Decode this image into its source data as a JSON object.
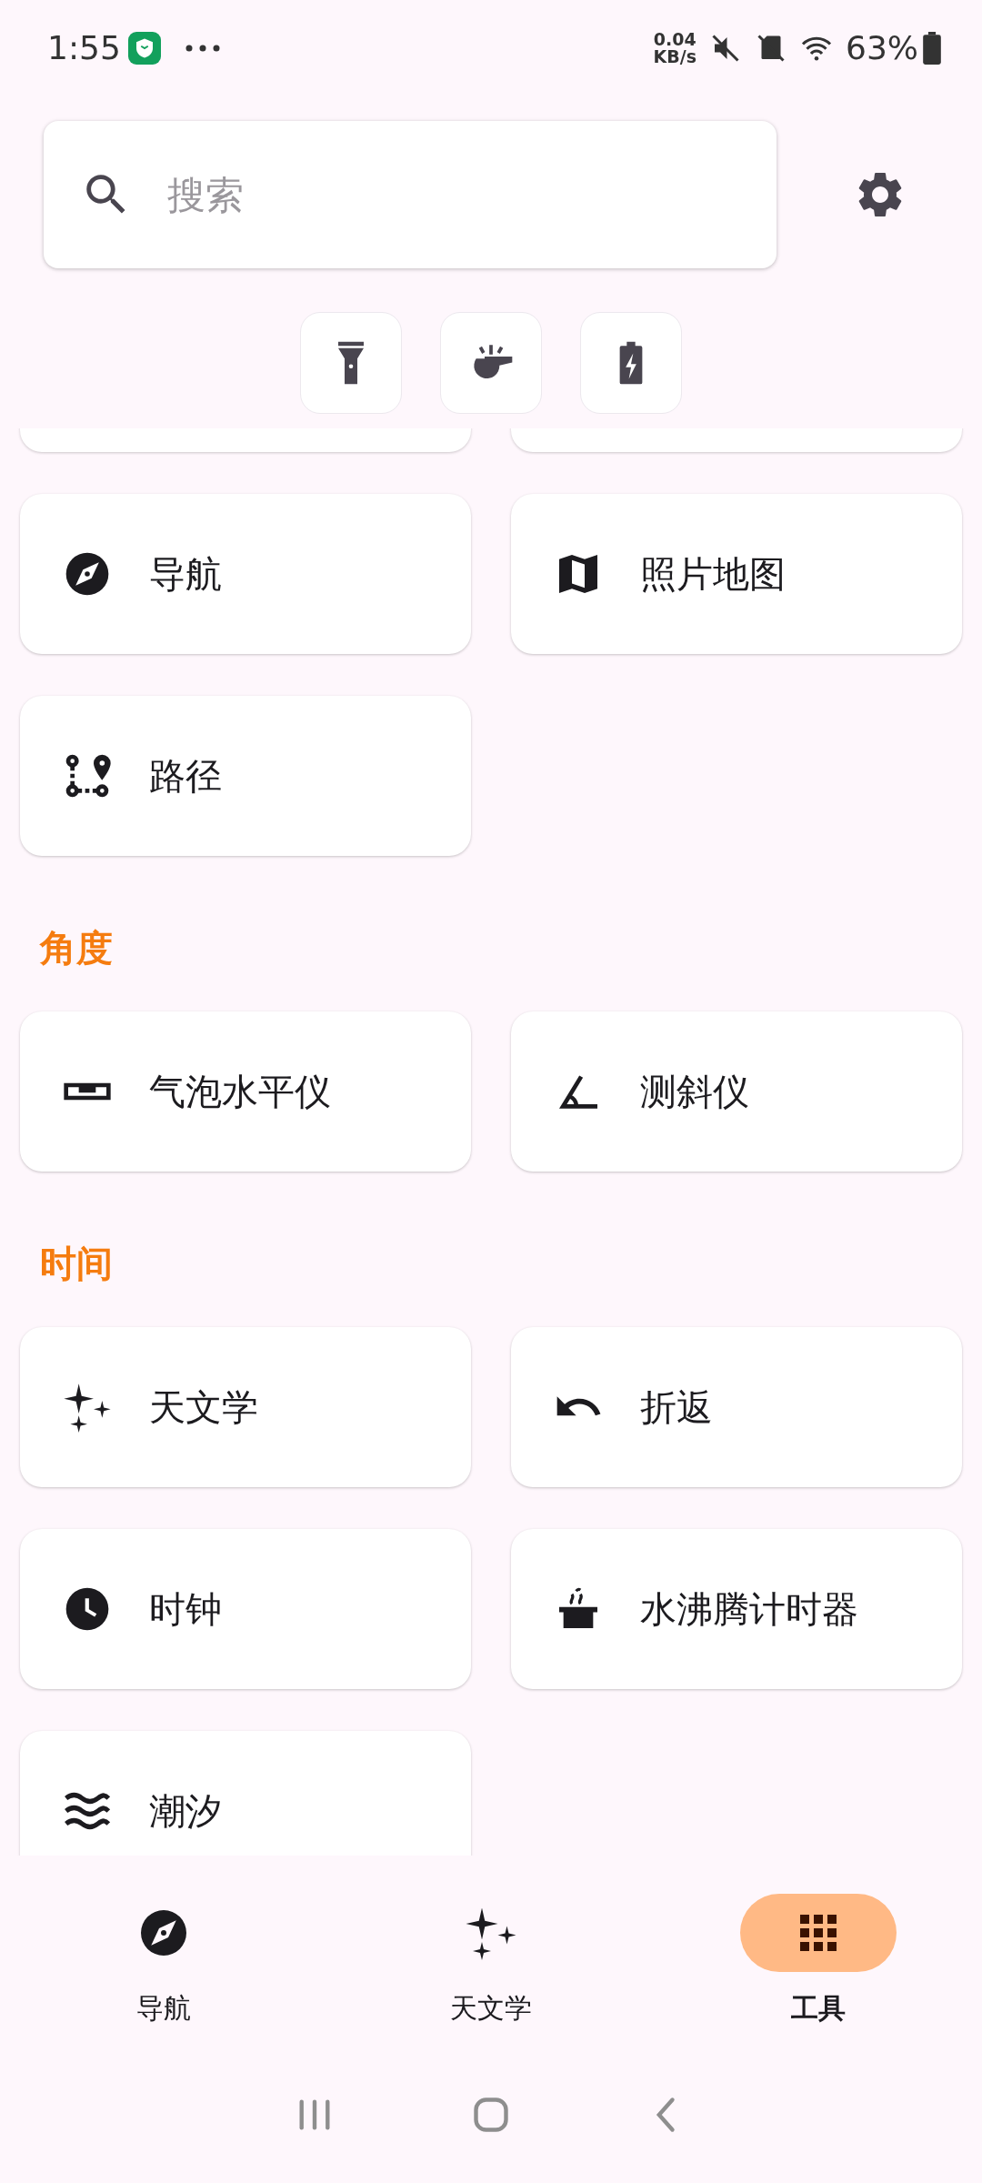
{
  "status_bar": {
    "time": "1:55",
    "speed_value": "0.04",
    "speed_unit": "KB/s",
    "battery": "63%"
  },
  "search": {
    "placeholder": "搜索"
  },
  "quick_actions": [
    {
      "kind": "flashlight"
    },
    {
      "kind": "whistle"
    },
    {
      "kind": "battery"
    }
  ],
  "sections": [
    {
      "items": [
        {
          "label": "导航",
          "kind": "compass"
        },
        {
          "label": "照片地图",
          "kind": "map"
        },
        {
          "label": "路径",
          "kind": "route"
        }
      ]
    },
    {
      "title": "角度",
      "items": [
        {
          "label": "气泡水平仪",
          "kind": "level"
        },
        {
          "label": "测斜仪",
          "kind": "inclinometer"
        }
      ]
    },
    {
      "title": "时间",
      "items": [
        {
          "label": "天文学",
          "kind": "stars"
        },
        {
          "label": "折返",
          "kind": "undo"
        },
        {
          "label": "时钟",
          "kind": "clock"
        },
        {
          "label": "水沸腾计时器",
          "kind": "pot"
        },
        {
          "label": "潮汐",
          "kind": "waves"
        }
      ]
    }
  ],
  "bottom_nav": [
    {
      "label": "导航",
      "kind": "compass",
      "selected": false
    },
    {
      "label": "天文学",
      "kind": "stars",
      "selected": false
    },
    {
      "label": "工具",
      "kind": "grid",
      "selected": true
    }
  ]
}
